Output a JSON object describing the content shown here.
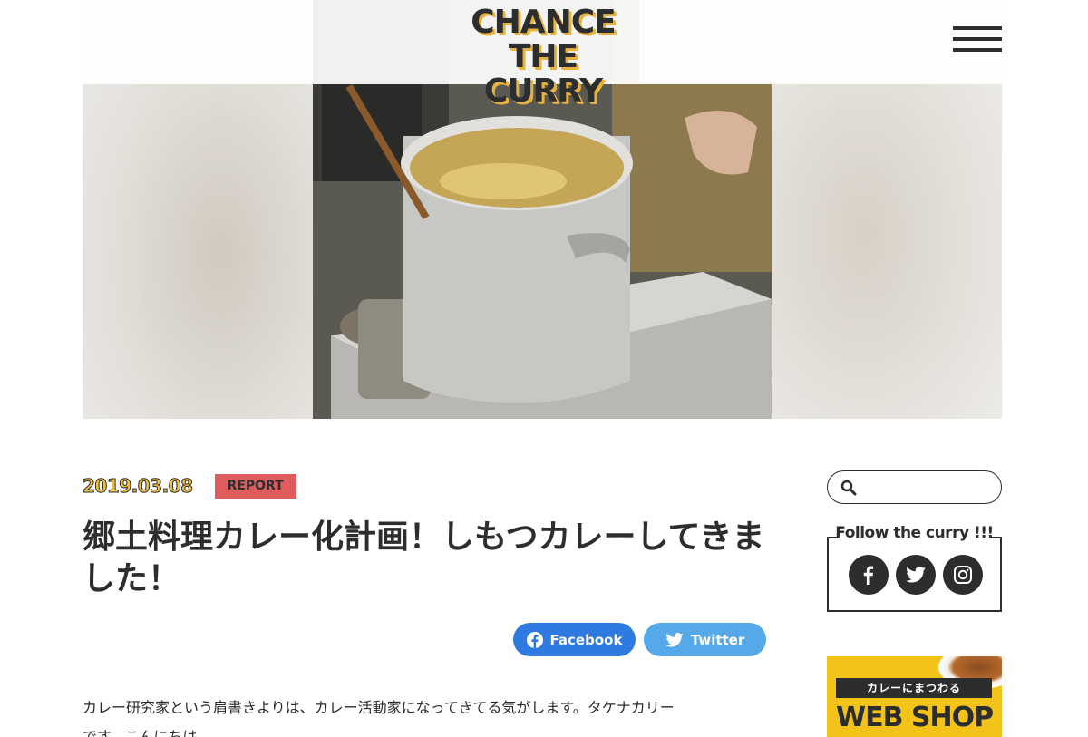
{
  "header": {
    "logo_line1": "CHANCE",
    "logo_line2": "THE CURRY"
  },
  "article": {
    "date": "2019.03.08",
    "category": "REPORT",
    "title": "郷土料理カレー化計画！しもつカレーしてきました！",
    "share_facebook": "Facebook",
    "share_twitter": "Twitter",
    "body": "カレー研究家という肩書きよりは、カレー活動家になってきてる気がします。タケナカリーです。こんにちは。"
  },
  "sidebar": {
    "search_placeholder": "",
    "follow_title": "Follow the curry !!!",
    "banner_sub": "カレーにまつわる",
    "banner_main": "WEB SHOP"
  },
  "colors": {
    "dark": "#2b2d2e",
    "accent_yellow": "#f0c040",
    "tag_red": "#e05b5b",
    "facebook_blue": "#2f7ae0",
    "twitter_blue": "#56a9e8",
    "banner_yellow": "#f4c319"
  },
  "icons": [
    "menu-icon",
    "facebook-icon",
    "twitter-icon",
    "search-icon",
    "instagram-icon"
  ]
}
